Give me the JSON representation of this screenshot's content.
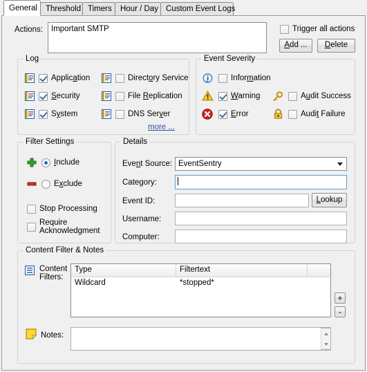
{
  "tabs": [
    {
      "label": "General",
      "active": true
    },
    {
      "label": "Threshold",
      "active": false
    },
    {
      "label": "Timers",
      "active": false
    },
    {
      "label": "Hour / Day",
      "active": false
    },
    {
      "label": "Custom Event Logs",
      "active": false
    }
  ],
  "actions": {
    "label": "Actions:",
    "items": [
      "Important SMTP"
    ],
    "trigger_all_label": "Trigger all actions",
    "trigger_all_checked": false,
    "add_label": "Add ...",
    "delete_label": "Delete"
  },
  "log": {
    "title": "Log",
    "more_label": "more ...",
    "items": [
      {
        "label": "Application",
        "checked": true
      },
      {
        "label": "Security",
        "checked": true
      },
      {
        "label": "System",
        "checked": true
      },
      {
        "label": "Directory Service",
        "checked": false
      },
      {
        "label": "File Replication",
        "checked": false
      },
      {
        "label": "DNS Server",
        "checked": false
      }
    ]
  },
  "severity": {
    "title": "Event Severity",
    "items": [
      {
        "label": "Information",
        "checked": false,
        "icon": "information-icon"
      },
      {
        "label": "Warning",
        "checked": true,
        "icon": "warning-icon"
      },
      {
        "label": "Error",
        "checked": true,
        "icon": "error-icon"
      },
      {
        "label": "Audit Success",
        "checked": false,
        "icon": "key-icon"
      },
      {
        "label": "Audit Failure",
        "checked": false,
        "icon": "lock-icon"
      }
    ]
  },
  "filter_settings": {
    "title": "Filter Settings",
    "include_label": "Include",
    "exclude_label": "Exclude",
    "selected": "include",
    "stop_processing_label": "Stop Processing",
    "stop_processing_checked": false,
    "require_ack_label": "Require Acknowledgment",
    "require_ack_checked": false
  },
  "details": {
    "title": "Details",
    "event_source_label": "Event Source:",
    "event_source_value": "EventSentry",
    "category_label": "Category:",
    "category_value": "",
    "event_id_label": "Event ID:",
    "event_id_value": "",
    "lookup_label": "Lookup",
    "username_label": "Username:",
    "username_value": "",
    "computer_label": "Computer:",
    "computer_value": ""
  },
  "content_filter": {
    "title": "Content Filter & Notes",
    "content_filters_label_line1": "Content",
    "content_filters_label_line2": "Filters:",
    "columns": [
      "Type",
      "Filtertext",
      ""
    ],
    "rows": [
      {
        "type": "Wildcard",
        "filtertext": "*stopped*"
      }
    ],
    "add_label": "+",
    "remove_label": "-",
    "notes_label": "Notes:",
    "notes_value": ""
  },
  "colors": {
    "dialog_bg": "#f0f0f0",
    "accent_link": "#2c52a0",
    "check_mark": "#3a6ea5",
    "include_plus": "#2fa12f",
    "exclude_minus": "#d03030",
    "warning_icon": "#ffc72c",
    "error_icon": "#cf2020",
    "info_icon": "#3a78c0",
    "key_icon": "#e3b23c",
    "note_icon": "#ffd733"
  }
}
